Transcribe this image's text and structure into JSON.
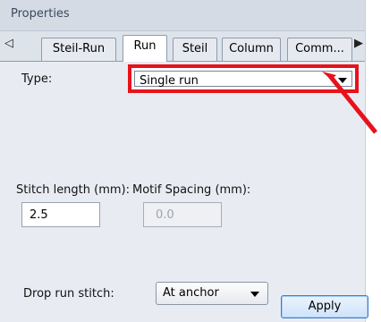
{
  "panel": {
    "title": "Properties"
  },
  "tabs": {
    "scroll_left": "◁",
    "scroll_right": "▶",
    "items": [
      {
        "label": "Steil-Run"
      },
      {
        "label": "Run",
        "active": true
      },
      {
        "label": "Steil"
      },
      {
        "label": "Column"
      },
      {
        "label": "Comm..."
      }
    ]
  },
  "form": {
    "type_label": "Type:",
    "type_value": "Single run",
    "stitch_length_label": "Stitch length (mm):",
    "stitch_length_value": "2.5",
    "motif_spacing_label": "Motif Spacing (mm):",
    "motif_spacing_value": "0.0",
    "drop_run_label": "Drop run stitch:",
    "drop_run_value": "At anchor",
    "apply_label": "Apply"
  },
  "colors": {
    "highlight": "#e8121c",
    "panel_bg": "#e8ecf2"
  },
  "icons": {
    "dropdown": "chevron-down-icon",
    "annotation": "red-arrow-icon"
  }
}
